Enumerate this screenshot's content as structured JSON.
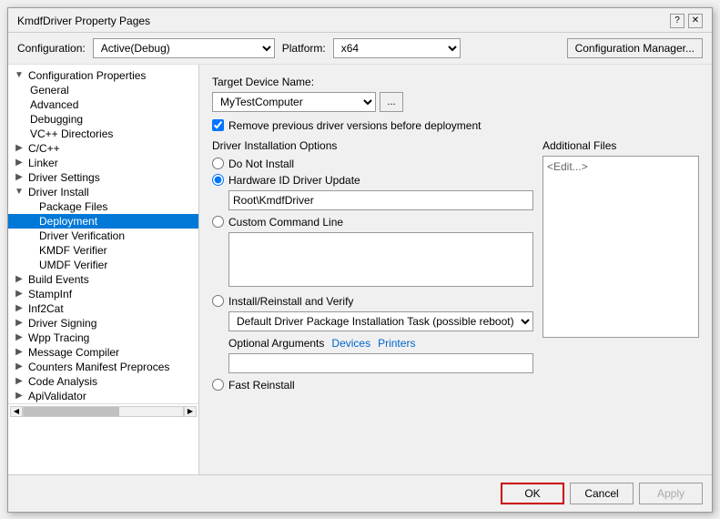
{
  "dialog": {
    "title": "KmdfDriver Property Pages",
    "help_icon": "?",
    "close_icon": "✕"
  },
  "config_bar": {
    "config_label": "Configuration:",
    "config_value": "Active(Debug)",
    "platform_label": "Platform:",
    "platform_value": "x64",
    "manager_btn": "Configuration Manager..."
  },
  "sidebar": {
    "items": [
      {
        "id": "config-properties",
        "label": "Configuration Properties",
        "level": 0,
        "expanded": true,
        "has_arrow": true,
        "arrow": "▼"
      },
      {
        "id": "general",
        "label": "General",
        "level": 1,
        "expanded": false,
        "has_arrow": false
      },
      {
        "id": "advanced",
        "label": "Advanced",
        "level": 1,
        "expanded": false,
        "has_arrow": false
      },
      {
        "id": "debugging",
        "label": "Debugging",
        "level": 1,
        "expanded": false,
        "has_arrow": false
      },
      {
        "id": "vc-directories",
        "label": "VC++ Directories",
        "level": 1,
        "expanded": false,
        "has_arrow": false
      },
      {
        "id": "c-cpp",
        "label": "C/C++",
        "level": 1,
        "expanded": false,
        "has_arrow": true,
        "arrow": "▶"
      },
      {
        "id": "linker",
        "label": "Linker",
        "level": 1,
        "expanded": false,
        "has_arrow": true,
        "arrow": "▶"
      },
      {
        "id": "driver-settings",
        "label": "Driver Settings",
        "level": 1,
        "expanded": false,
        "has_arrow": true,
        "arrow": "▶"
      },
      {
        "id": "driver-install",
        "label": "Driver Install",
        "level": 1,
        "expanded": true,
        "has_arrow": true,
        "arrow": "▼"
      },
      {
        "id": "package-files",
        "label": "Package Files",
        "level": 2,
        "expanded": false,
        "has_arrow": false
      },
      {
        "id": "deployment",
        "label": "Deployment",
        "level": 2,
        "expanded": false,
        "has_arrow": false,
        "selected": true
      },
      {
        "id": "driver-verification",
        "label": "Driver Verification",
        "level": 2,
        "expanded": false,
        "has_arrow": false
      },
      {
        "id": "kmdf-verifier",
        "label": "KMDF Verifier",
        "level": 2,
        "expanded": false,
        "has_arrow": false
      },
      {
        "id": "umdf-verifier",
        "label": "UMDF Verifier",
        "level": 2,
        "expanded": false,
        "has_arrow": false
      },
      {
        "id": "build-events",
        "label": "Build Events",
        "level": 1,
        "expanded": false,
        "has_arrow": true,
        "arrow": "▶"
      },
      {
        "id": "stampinf",
        "label": "StampInf",
        "level": 1,
        "expanded": false,
        "has_arrow": true,
        "arrow": "▶"
      },
      {
        "id": "inf2cat",
        "label": "Inf2Cat",
        "level": 1,
        "expanded": false,
        "has_arrow": true,
        "arrow": "▶"
      },
      {
        "id": "driver-signing",
        "label": "Driver Signing",
        "level": 1,
        "expanded": false,
        "has_arrow": true,
        "arrow": "▶"
      },
      {
        "id": "wpp-tracing",
        "label": "Wpp Tracing",
        "level": 1,
        "expanded": false,
        "has_arrow": true,
        "arrow": "▶"
      },
      {
        "id": "message-compiler",
        "label": "Message Compiler",
        "level": 1,
        "expanded": false,
        "has_arrow": true,
        "arrow": "▶"
      },
      {
        "id": "counters-manifest",
        "label": "Counters Manifest Preproces",
        "level": 1,
        "expanded": false,
        "has_arrow": true,
        "arrow": "▶"
      },
      {
        "id": "code-analysis",
        "label": "Code Analysis",
        "level": 1,
        "expanded": false,
        "has_arrow": true,
        "arrow": "▶"
      },
      {
        "id": "api-validator",
        "label": "ApiValidator",
        "level": 1,
        "expanded": false,
        "has_arrow": true,
        "arrow": "▶"
      }
    ]
  },
  "right_panel": {
    "target_device_label": "Target Device Name:",
    "target_device_value": "MyTestComputer",
    "browse_btn": "...",
    "remove_checkbox_label": "Remove previous driver versions before deployment",
    "remove_checked": true,
    "driver_install_section": "Driver Installation Options",
    "radio_do_not_install": "Do Not Install",
    "radio_hardware_id": "Hardware ID Driver Update",
    "hardware_id_value": "Root\\KmdfDriver",
    "radio_custom": "Custom Command Line",
    "custom_textarea_value": "",
    "radio_install_reinstall": "Install/Reinstall and Verify",
    "install_dropdown_value": "Default Driver Package Installation Task (possible reboot)",
    "optional_args_label": "Optional Arguments",
    "devices_link": "Devices",
    "printers_link": "Printers",
    "optional_args_value": "",
    "radio_fast_reinstall": "Fast Reinstall",
    "additional_files_label": "Additional Files",
    "additional_files_value": "<Edit...>",
    "hardware_id_selected": true,
    "install_reinstall_selected": false
  },
  "buttons": {
    "ok": "OK",
    "cancel": "Cancel",
    "apply": "Apply"
  }
}
